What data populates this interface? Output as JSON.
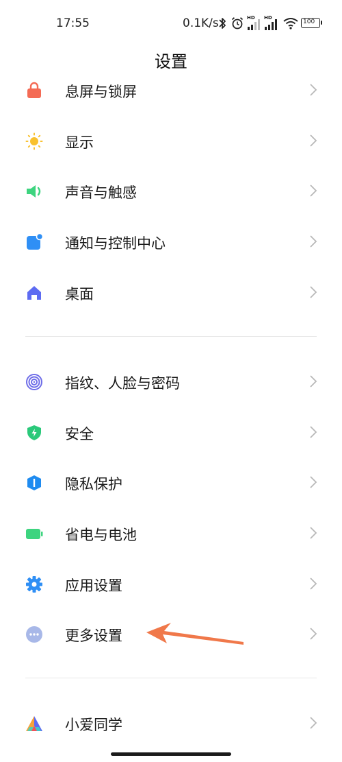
{
  "status_bar": {
    "time": "17:55",
    "network_speed": "0.1K/s",
    "sim1_label": "HD",
    "sim2_label": "HD",
    "battery": "100",
    "icons": [
      "bluetooth-icon",
      "alarm-icon",
      "signal-icon",
      "signal-icon",
      "wifi-icon",
      "battery-icon"
    ]
  },
  "header": {
    "title": "设置"
  },
  "group1": [
    {
      "label": "息屏与锁屏",
      "icon": "lock-icon",
      "color": "#f46b55"
    },
    {
      "label": "显示",
      "icon": "sun-icon",
      "color": "#f9c12f"
    },
    {
      "label": "声音与触感",
      "icon": "speaker-icon",
      "color": "#3dd47f"
    },
    {
      "label": "通知与控制中心",
      "icon": "notification-icon",
      "color": "#2f8ff5"
    },
    {
      "label": "桌面",
      "icon": "home-icon",
      "color": "#5d6bf2"
    }
  ],
  "group2": [
    {
      "label": "指纹、人脸与密码",
      "icon": "fingerprint-icon",
      "color": "#6f6ee8"
    },
    {
      "label": "安全",
      "icon": "shield-icon",
      "color": "#2ac97a"
    },
    {
      "label": "隐私保护",
      "icon": "privacy-icon",
      "color": "#1e8bf0"
    },
    {
      "label": "省电与电池",
      "icon": "battery-icon",
      "color": "#3dd47f"
    },
    {
      "label": "应用设置",
      "icon": "gear-icon",
      "color": "#2f8ff5"
    },
    {
      "label": "更多设置",
      "icon": "more-icon",
      "color": "#a8b8e8"
    }
  ],
  "group3": [
    {
      "label": "小爱同学",
      "icon": "xiaoai-icon",
      "color": "#5d6bf2"
    }
  ],
  "annotation": {
    "arrow_color": "#f0784a"
  }
}
